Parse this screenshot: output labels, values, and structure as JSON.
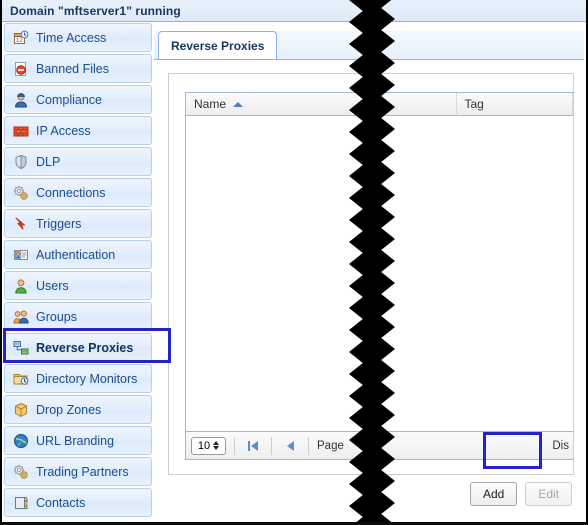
{
  "header": {
    "title": "Domain \"mftserver1\" running"
  },
  "sidebar": {
    "items": [
      {
        "label": "Time Access",
        "icon": "calendar-clock-icon",
        "selected": false
      },
      {
        "label": "Banned Files",
        "icon": "banned-file-icon",
        "selected": false
      },
      {
        "label": "Compliance",
        "icon": "officer-icon",
        "selected": false
      },
      {
        "label": "IP Access",
        "icon": "firewall-icon",
        "selected": false
      },
      {
        "label": "DLP",
        "icon": "shield-icon",
        "selected": false
      },
      {
        "label": "Connections",
        "icon": "gears-icon",
        "selected": false
      },
      {
        "label": "Triggers",
        "icon": "lightning-arrow-icon",
        "selected": false
      },
      {
        "label": "Authentication",
        "icon": "id-card-icon",
        "selected": false
      },
      {
        "label": "Users",
        "icon": "user-icon",
        "selected": false
      },
      {
        "label": "Groups",
        "icon": "users-group-icon",
        "selected": false
      },
      {
        "label": "Reverse Proxies",
        "icon": "network-nodes-icon",
        "selected": true
      },
      {
        "label": "Directory Monitors",
        "icon": "folder-clock-icon",
        "selected": false
      },
      {
        "label": "Drop Zones",
        "icon": "package-icon",
        "selected": false
      },
      {
        "label": "URL Branding",
        "icon": "globe-icon",
        "selected": false
      },
      {
        "label": "Trading Partners",
        "icon": "gears-icon",
        "selected": false
      },
      {
        "label": "Contacts",
        "icon": "address-book-icon",
        "selected": false
      }
    ]
  },
  "main": {
    "tabs": [
      {
        "label": "Reverse Proxies",
        "active": true
      }
    ],
    "grid": {
      "columns": [
        {
          "label": "Name",
          "sorted": "asc"
        },
        {
          "label": "Tag"
        }
      ],
      "rows": [],
      "footer": {
        "page_size": "10",
        "page_label": "Page",
        "display_label": "Dis"
      }
    },
    "buttons": [
      {
        "label": "Add",
        "disabled": false,
        "highlighted": true
      },
      {
        "label": "Edit",
        "disabled": true,
        "highlighted": false
      }
    ]
  },
  "annotations": {
    "color": "#2323c8",
    "targets": [
      "sidebar-item-reverse-proxies",
      "add-button"
    ]
  },
  "redaction": {
    "style": "zigzag-band",
    "color": "#000000"
  }
}
